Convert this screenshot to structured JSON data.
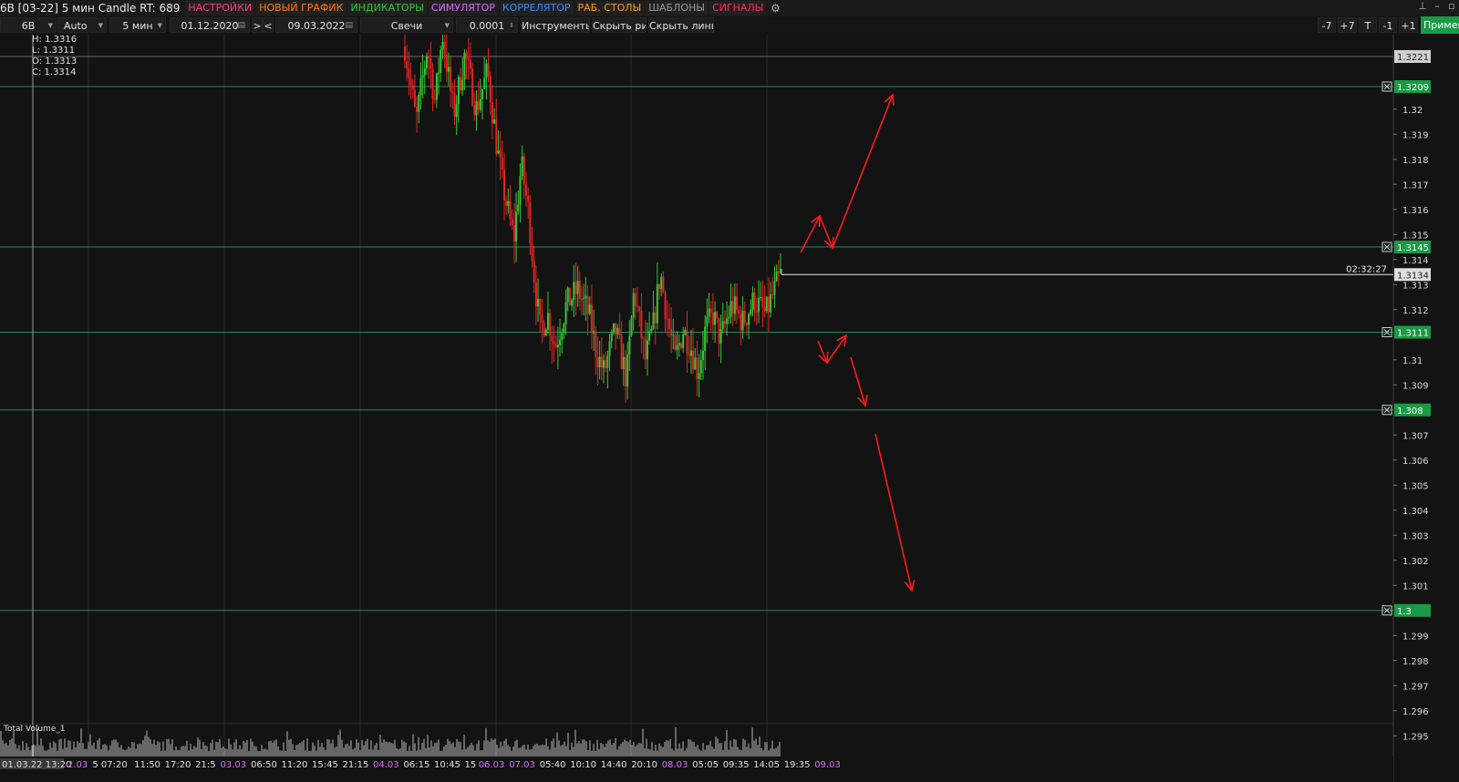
{
  "window": {
    "title": "6B [03-22] 5 мин Candle RT: 689",
    "menu": [
      {
        "label": "НАСТРОЙКИ",
        "color": "#ff3a7c"
      },
      {
        "label": "НОВЫЙ ГРАФИК",
        "color": "#ff7a1a"
      },
      {
        "label": "ИНДИКАТОРЫ",
        "color": "#35c735"
      },
      {
        "label": "СИМУЛЯТОР",
        "color": "#d86cff"
      },
      {
        "label": "КОРРЕЛЯТОР",
        "color": "#3a8cff"
      },
      {
        "label": "РАБ. СТОЛЫ",
        "color": "#ff9a1a"
      },
      {
        "label": "ШАБЛОНЫ",
        "color": "#9a9a9a"
      },
      {
        "label": "СИГНАЛЫ",
        "color": "#ff2a5a"
      }
    ],
    "settings_icon": "gear-icon",
    "window_controls": [
      "pin-icon",
      "minimize-icon",
      "restore-icon"
    ]
  },
  "toolbar": {
    "symbol": "6B",
    "scale": "Auto",
    "timeframe": "5 мин",
    "date_from": "01.12.2020",
    "nav_next": ">",
    "nav_prev": "<",
    "date_to": "09.03.2022",
    "chart_type": "Свечи",
    "tick": "0.0001",
    "tools": "Инструменты",
    "hide_drawings": "Скрыть рис.",
    "hide_lines": "Скрыть линии",
    "step_buttons": [
      "-7",
      "+7",
      "T",
      "-1",
      "+1"
    ],
    "apply": "Примен"
  },
  "ohlc": {
    "high": "H: 1.3316",
    "low": "L: 1.3311",
    "open": "O: 1.3313",
    "close": "C: 1.3314"
  },
  "volume_label": "Total Volume_1",
  "crosshair_date": "01.03.22 13:20",
  "timer": "02:32:27",
  "colors": {
    "background": "#131313",
    "grid": "#2a2a2a",
    "level_line": "#1e8a55",
    "level_badge": "#1a9a45",
    "bull_candle": "#35c735",
    "bear_candle": "#e02525",
    "arrow": "#ff1a1a",
    "volume": "#b8b8b8"
  },
  "chart_data": {
    "type": "candlestick",
    "symbol": "6B [03-22]",
    "timeframe": "5 мин",
    "ylim": [
      1.2945,
      1.3235
    ],
    "price_ticks": [
      "1.32",
      "1.319",
      "1.318",
      "1.317",
      "1.316",
      "1.315",
      "1.314",
      "1.313",
      "1.312",
      "1.31",
      "1.309",
      "1.307",
      "1.306",
      "1.305",
      "1.304",
      "1.303",
      "1.302",
      "1.301",
      "1.299",
      "1.298",
      "1.297",
      "1.296",
      "1.295"
    ],
    "horizontal_levels": [
      {
        "label": "1.3221",
        "value": 1.3221,
        "style": "gray"
      },
      {
        "label": "1.3209",
        "value": 1.3209,
        "style": "green"
      },
      {
        "label": "1.3145",
        "value": 1.3145,
        "style": "green"
      },
      {
        "label": "1.3111",
        "value": 1.3111,
        "style": "green"
      },
      {
        "label": "1.308",
        "value": 1.308,
        "style": "green"
      },
      {
        "label": "1.3",
        "value": 1.3,
        "style": "green"
      }
    ],
    "current_price": {
      "label": "1.3134",
      "value": 1.3134
    },
    "time_labels": [
      {
        "text": "01.03.22 13:20",
        "highlight": false
      },
      {
        "text": "2.03",
        "highlight": true
      },
      {
        "text": "5 07:20",
        "highlight": false
      },
      {
        "text": "11:50",
        "highlight": false
      },
      {
        "text": "17:20",
        "highlight": false
      },
      {
        "text": "21:5",
        "highlight": false
      },
      {
        "text": "03.03",
        "highlight": true
      },
      {
        "text": "06:50",
        "highlight": false
      },
      {
        "text": "11:20",
        "highlight": false
      },
      {
        "text": "15:45",
        "highlight": false
      },
      {
        "text": "21:15",
        "highlight": false
      },
      {
        "text": "04.03",
        "highlight": true
      },
      {
        "text": "06:15",
        "highlight": false
      },
      {
        "text": "10:45",
        "highlight": false
      },
      {
        "text": "15",
        "highlight": false
      },
      {
        "text": "06.03",
        "highlight": true
      },
      {
        "text": "07.03",
        "highlight": true
      },
      {
        "text": "05:40",
        "highlight": false
      },
      {
        "text": "10:10",
        "highlight": false
      },
      {
        "text": "14:40",
        "highlight": false
      },
      {
        "text": "20:10",
        "highlight": false
      },
      {
        "text": "08.03",
        "highlight": true
      },
      {
        "text": "05:05",
        "highlight": false
      },
      {
        "text": "09:35",
        "highlight": false
      },
      {
        "text": "14:05",
        "highlight": false
      },
      {
        "text": "19:35",
        "highlight": false
      },
      {
        "text": "09.03",
        "highlight": true
      }
    ],
    "price_path": [
      [
        0,
        1.3225
      ],
      [
        0.03,
        1.3195
      ],
      [
        0.06,
        1.3225
      ],
      [
        0.08,
        1.3203
      ],
      [
        0.1,
        1.323
      ],
      [
        0.13,
        1.3198
      ],
      [
        0.16,
        1.3222
      ],
      [
        0.19,
        1.32
      ],
      [
        0.22,
        1.3215
      ],
      [
        0.245,
        1.3185
      ],
      [
        0.26,
        1.317
      ],
      [
        0.28,
        1.3155
      ],
      [
        0.29,
        1.3148
      ],
      [
        0.31,
        1.3178
      ],
      [
        0.33,
        1.3158
      ],
      [
        0.345,
        1.3132
      ],
      [
        0.36,
        1.3112
      ],
      [
        0.38,
        1.3118
      ],
      [
        0.4,
        1.3105
      ],
      [
        0.43,
        1.3122
      ],
      [
        0.46,
        1.3128
      ],
      [
        0.49,
        1.3118
      ],
      [
        0.51,
        1.3103
      ],
      [
        0.53,
        1.3095
      ],
      [
        0.56,
        1.3112
      ],
      [
        0.59,
        1.3092
      ],
      [
        0.61,
        1.3128
      ],
      [
        0.64,
        1.31
      ],
      [
        0.66,
        1.3112
      ],
      [
        0.68,
        1.3135
      ],
      [
        0.7,
        1.3115
      ],
      [
        0.72,
        1.31
      ],
      [
        0.74,
        1.3112
      ],
      [
        0.76,
        1.3106
      ],
      [
        0.78,
        1.3095
      ],
      [
        0.8,
        1.3112
      ],
      [
        0.82,
        1.3118
      ],
      [
        0.84,
        1.3108
      ],
      [
        0.87,
        1.3122
      ],
      [
        0.9,
        1.3115
      ],
      [
        0.93,
        1.3124
      ],
      [
        0.96,
        1.3118
      ],
      [
        1.0,
        1.3134
      ]
    ]
  }
}
